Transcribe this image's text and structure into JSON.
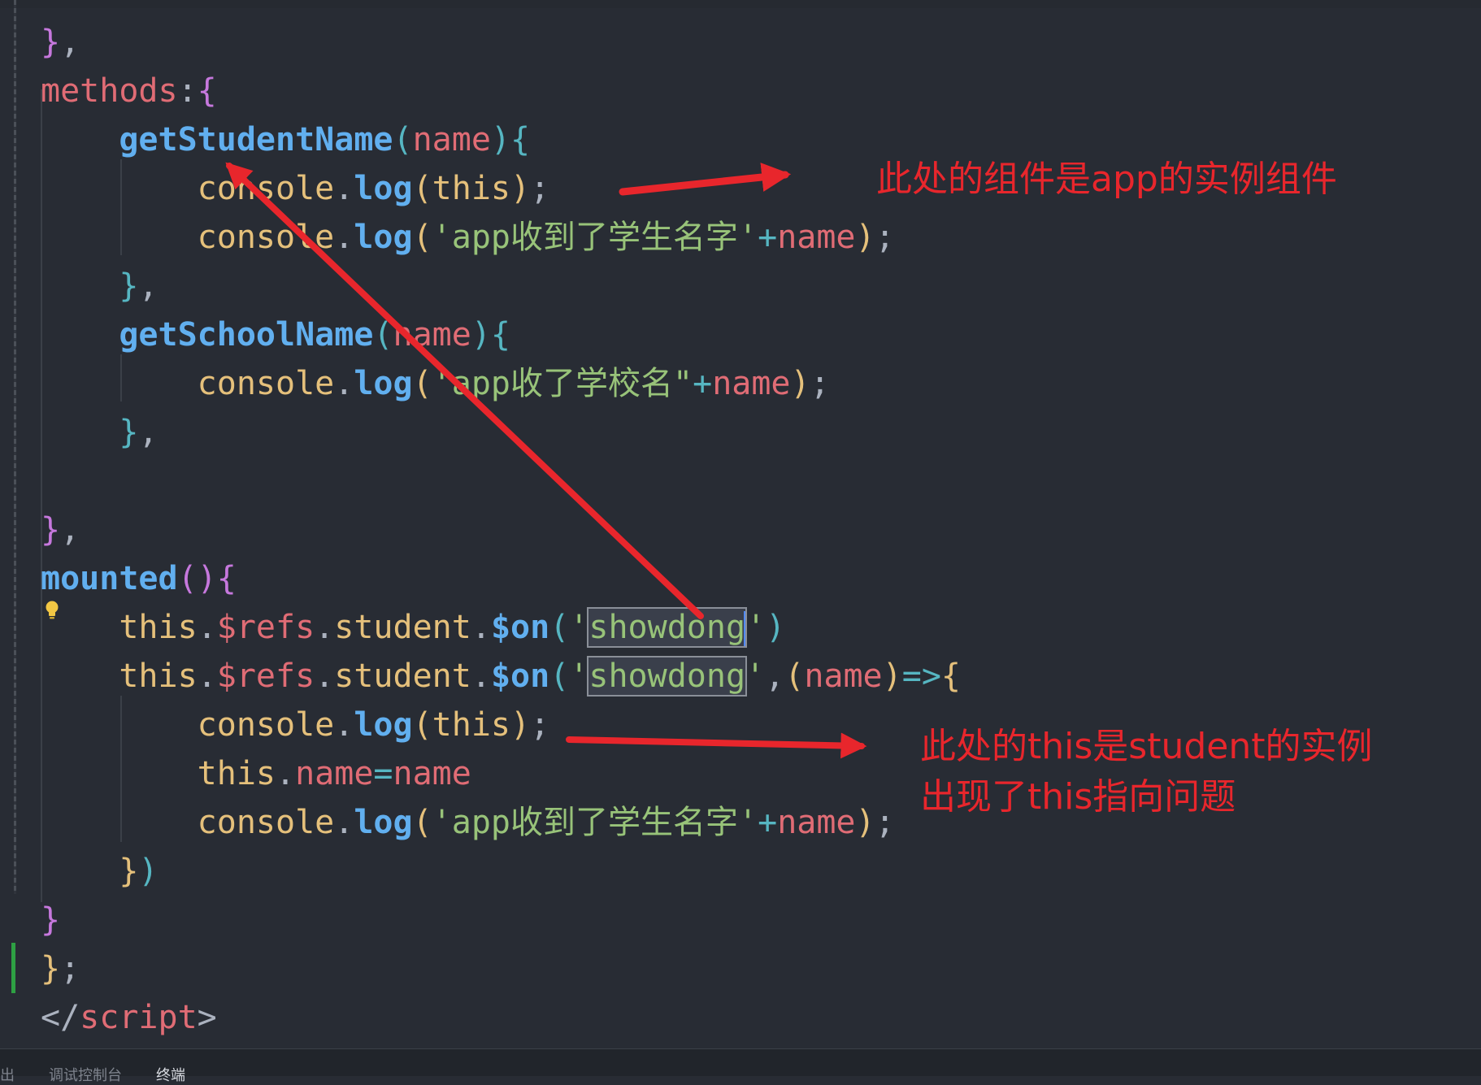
{
  "editor": {
    "lines": [
      [
        {
          "t": "}",
          "c": "p1"
        },
        {
          "t": ",",
          "c": "punc"
        }
      ],
      [
        {
          "t": "methods",
          "c": "kw-m"
        },
        {
          "t": ":",
          "c": "punc"
        },
        {
          "t": "{",
          "c": "p1"
        }
      ],
      [
        {
          "t": "    ",
          "c": "punc"
        },
        {
          "t": "getStudentName",
          "c": "fn"
        },
        {
          "t": "(",
          "c": "p2"
        },
        {
          "t": "name",
          "c": "kw-m"
        },
        {
          "t": ")",
          "c": "p2"
        },
        {
          "t": "{",
          "c": "p2"
        }
      ],
      [
        {
          "t": "        ",
          "c": "punc"
        },
        {
          "t": "console",
          "c": "obj"
        },
        {
          "t": ".",
          "c": "punc"
        },
        {
          "t": "log",
          "c": "fn"
        },
        {
          "t": "(",
          "c": "p3"
        },
        {
          "t": "this",
          "c": "obj"
        },
        {
          "t": ")",
          "c": "p3"
        },
        {
          "t": ";",
          "c": "punc"
        }
      ],
      [
        {
          "t": "        ",
          "c": "punc"
        },
        {
          "t": "console",
          "c": "obj"
        },
        {
          "t": ".",
          "c": "punc"
        },
        {
          "t": "log",
          "c": "fn"
        },
        {
          "t": "(",
          "c": "p3"
        },
        {
          "t": "'app收到了学生名字'",
          "c": "str"
        },
        {
          "t": "+",
          "c": "op"
        },
        {
          "t": "name",
          "c": "kw-m"
        },
        {
          "t": ")",
          "c": "p3"
        },
        {
          "t": ";",
          "c": "punc"
        }
      ],
      [
        {
          "t": "    ",
          "c": "punc"
        },
        {
          "t": "}",
          "c": "p2"
        },
        {
          "t": ",",
          "c": "punc"
        }
      ],
      [
        {
          "t": "    ",
          "c": "punc"
        },
        {
          "t": "getSchoolName",
          "c": "fn"
        },
        {
          "t": "(",
          "c": "p2"
        },
        {
          "t": "name",
          "c": "kw-m"
        },
        {
          "t": ")",
          "c": "p2"
        },
        {
          "t": "{",
          "c": "p2"
        }
      ],
      [
        {
          "t": "        ",
          "c": "punc"
        },
        {
          "t": "console",
          "c": "obj"
        },
        {
          "t": ".",
          "c": "punc"
        },
        {
          "t": "log",
          "c": "fn"
        },
        {
          "t": "(",
          "c": "p3"
        },
        {
          "t": "'app收了学校名\"",
          "c": "str"
        },
        {
          "t": "+",
          "c": "op"
        },
        {
          "t": "name",
          "c": "kw-m"
        },
        {
          "t": ")",
          "c": "p3"
        },
        {
          "t": ";",
          "c": "punc"
        }
      ],
      [
        {
          "t": "    ",
          "c": "punc"
        },
        {
          "t": "}",
          "c": "p2"
        },
        {
          "t": ",",
          "c": "punc"
        }
      ],
      [],
      [
        {
          "t": "}",
          "c": "p1"
        },
        {
          "t": ",",
          "c": "punc"
        }
      ],
      [
        {
          "t": "mounted",
          "c": "fn"
        },
        {
          "t": "()",
          "c": "p1"
        },
        {
          "t": "{",
          "c": "p1"
        }
      ],
      [
        {
          "t": "    ",
          "c": "punc"
        },
        {
          "t": "this",
          "c": "obj"
        },
        {
          "t": ".",
          "c": "punc"
        },
        {
          "t": "$refs",
          "c": "kw-m"
        },
        {
          "t": ".",
          "c": "punc"
        },
        {
          "t": "student",
          "c": "obj"
        },
        {
          "t": ".",
          "c": "punc"
        },
        {
          "t": "$on",
          "c": "fn"
        },
        {
          "t": "(",
          "c": "p2"
        },
        {
          "t": "'",
          "c": "str"
        },
        {
          "t": "showdong",
          "c": "str",
          "hl": true,
          "caret": true
        },
        {
          "t": "'",
          "c": "str"
        },
        {
          "t": ")",
          "c": "p2"
        }
      ],
      [
        {
          "t": "    ",
          "c": "punc"
        },
        {
          "t": "this",
          "c": "obj"
        },
        {
          "t": ".",
          "c": "punc"
        },
        {
          "t": "$refs",
          "c": "kw-m"
        },
        {
          "t": ".",
          "c": "punc"
        },
        {
          "t": "student",
          "c": "obj"
        },
        {
          "t": ".",
          "c": "punc"
        },
        {
          "t": "$on",
          "c": "fn"
        },
        {
          "t": "(",
          "c": "p2"
        },
        {
          "t": "'",
          "c": "str"
        },
        {
          "t": "showdong",
          "c": "str",
          "hl": true
        },
        {
          "t": "'",
          "c": "str"
        },
        {
          "t": ",",
          "c": "punc"
        },
        {
          "t": "(",
          "c": "p3"
        },
        {
          "t": "name",
          "c": "kw-m"
        },
        {
          "t": ")",
          "c": "p3"
        },
        {
          "t": "=>",
          "c": "op"
        },
        {
          "t": "{",
          "c": "p3"
        }
      ],
      [
        {
          "t": "        ",
          "c": "punc"
        },
        {
          "t": "console",
          "c": "obj"
        },
        {
          "t": ".",
          "c": "punc"
        },
        {
          "t": "log",
          "c": "fn"
        },
        {
          "t": "(",
          "c": "p3"
        },
        {
          "t": "this",
          "c": "obj"
        },
        {
          "t": ")",
          "c": "p3"
        },
        {
          "t": ";",
          "c": "punc"
        }
      ],
      [
        {
          "t": "        ",
          "c": "punc"
        },
        {
          "t": "this",
          "c": "obj"
        },
        {
          "t": ".",
          "c": "punc"
        },
        {
          "t": "name",
          "c": "kw-m"
        },
        {
          "t": "=",
          "c": "op"
        },
        {
          "t": "name",
          "c": "kw-m"
        }
      ],
      [
        {
          "t": "        ",
          "c": "punc"
        },
        {
          "t": "console",
          "c": "obj"
        },
        {
          "t": ".",
          "c": "punc"
        },
        {
          "t": "log",
          "c": "fn"
        },
        {
          "t": "(",
          "c": "p3"
        },
        {
          "t": "'app收到了学生名字'",
          "c": "str"
        },
        {
          "t": "+",
          "c": "op"
        },
        {
          "t": "name",
          "c": "kw-m"
        },
        {
          "t": ")",
          "c": "p3"
        },
        {
          "t": ";",
          "c": "punc"
        }
      ],
      [
        {
          "t": "    ",
          "c": "punc"
        },
        {
          "t": "}",
          "c": "p3"
        },
        {
          "t": ")",
          "c": "p2"
        }
      ],
      [
        {
          "t": "}",
          "c": "p1"
        }
      ],
      [
        {
          "t": "}",
          "c": "p3"
        },
        {
          "t": ";",
          "c": "punc"
        }
      ],
      [
        {
          "t": "</",
          "c": "punc"
        },
        {
          "t": "script",
          "c": "tag"
        },
        {
          "t": ">",
          "c": "punc"
        }
      ]
    ]
  },
  "annotations": {
    "note_component": "此处的组件是app的实例组件",
    "note_this_line1": "此处的this是student的实例",
    "note_this_line2": "出现了this指向问题",
    "arrow_color": "#e8262c"
  },
  "panel": {
    "tab_output": "出",
    "tab_debug_console": "调试控制台",
    "tab_terminal": "终端"
  }
}
